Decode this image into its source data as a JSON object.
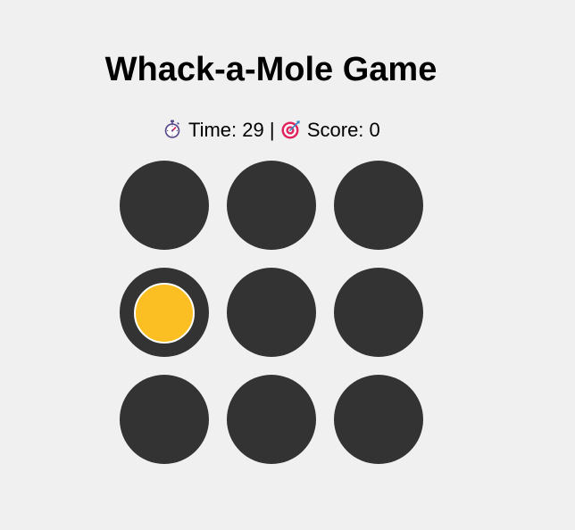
{
  "title": "Whack-a-Mole Game",
  "status": {
    "time_label": "Time: 29",
    "separator": "|",
    "score_label": "Score: 0",
    "timer_icon": "stopwatch-icon",
    "score_icon": "target-icon"
  },
  "board": {
    "rows": 3,
    "cols": 3,
    "active_hole": 3,
    "hole_color": "#333333",
    "mole_color": "#fbbf24",
    "background": "#f0f0f0"
  }
}
